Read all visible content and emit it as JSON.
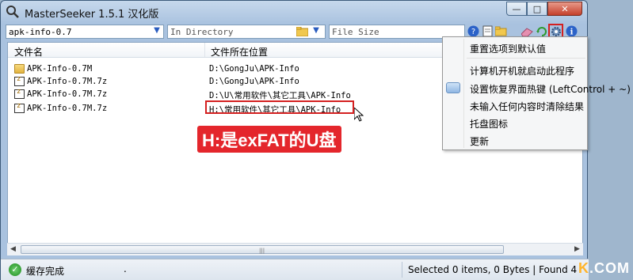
{
  "window": {
    "title": "MasterSeeker 1.5.1 汉化版",
    "caption": {
      "minimize": "—",
      "maximize": "□",
      "close": "✕"
    }
  },
  "toolbar": {
    "search_value": "apk-info-0.7",
    "directory_placeholder": "In Directory",
    "size_placeholder": "File Size",
    "icons": [
      "help-icon",
      "page-icon",
      "folder-open-icon",
      "eraser-icon",
      "refresh-icon",
      "settings-icon",
      "info-icon"
    ]
  },
  "list": {
    "columns": [
      "文件名",
      "文件所在位置"
    ],
    "rows": [
      {
        "name": "APK-Info-0.7M",
        "path": "D:\\GongJu\\APK-Info",
        "type": "folder"
      },
      {
        "name": "APK-Info-0.7M.7z",
        "path": "D:\\GongJu\\APK-Info",
        "type": "archive"
      },
      {
        "name": "APK-Info-0.7M.7z",
        "path": "D:\\U\\常用软件\\其它工具\\APK-Info",
        "type": "archive"
      },
      {
        "name": "APK-Info-0.7M.7z",
        "path": "H:\\常用软件\\其它工具\\APK-Info",
        "type": "archive"
      }
    ]
  },
  "annotation": "H:是exFAT的U盘",
  "menu": {
    "items": [
      "重置选项到默认值",
      "计算机开机就启动此程序",
      "设置恢复界面热键 (LeftControl + ~)",
      "未输入任何内容时清除结果",
      "托盘图标",
      "更新"
    ]
  },
  "statusbar": {
    "left": "缓存完成",
    "dot": ".",
    "right": "Selected 0 items, 0 Bytes | Found 4"
  },
  "watermark": {
    "prefix": "K",
    "suffix": ".COM"
  }
}
